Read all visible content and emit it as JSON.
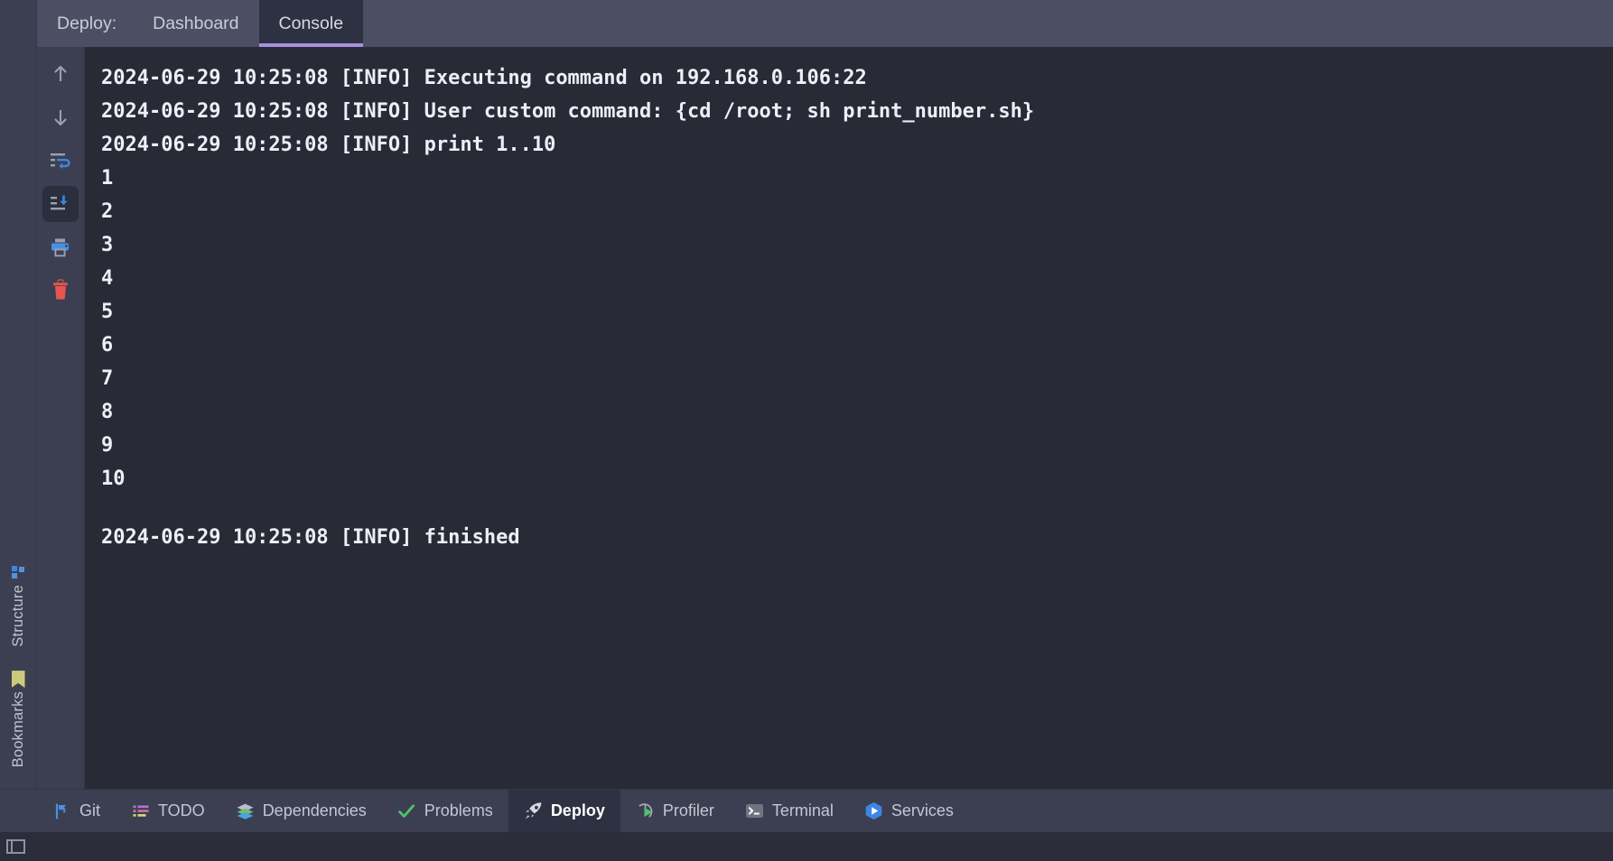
{
  "window": {
    "background_color": "#2b2d3a",
    "console_background": "#282b36",
    "panel_background": "#3c3f51",
    "accent_color": "#a98fe3"
  },
  "tabbar": {
    "title": "Deploy:",
    "tabs": [
      {
        "label": "Dashboard",
        "active": false
      },
      {
        "label": "Console",
        "active": true
      }
    ]
  },
  "action_toolbar": {
    "buttons": [
      {
        "name": "up-arrow-icon",
        "tooltip": "Up",
        "selected": false
      },
      {
        "name": "down-arrow-icon",
        "tooltip": "Down",
        "selected": false
      },
      {
        "name": "soft-wrap-icon",
        "tooltip": "Soft-Wrap",
        "selected": false
      },
      {
        "name": "scroll-to-end-icon",
        "tooltip": "Scroll to End",
        "selected": true
      },
      {
        "name": "print-icon",
        "tooltip": "Print",
        "selected": false
      },
      {
        "name": "trash-icon",
        "tooltip": "Clear All",
        "selected": false
      }
    ]
  },
  "console": {
    "lines": [
      {
        "text": "2024-06-29 10:25:08 [INFO] Executing command on 192.168.0.106:22",
        "kind": "log"
      },
      {
        "text": "2024-06-29 10:25:08 [INFO] User custom command: {cd /root; sh print_number.sh}",
        "kind": "log"
      },
      {
        "text": "2024-06-29 10:25:08 [INFO] print 1..10",
        "kind": "log"
      },
      {
        "text": "1",
        "kind": "out"
      },
      {
        "text": "2",
        "kind": "out"
      },
      {
        "text": "3",
        "kind": "out"
      },
      {
        "text": "4",
        "kind": "out"
      },
      {
        "text": "5",
        "kind": "out"
      },
      {
        "text": "6",
        "kind": "out"
      },
      {
        "text": "7",
        "kind": "out"
      },
      {
        "text": "8",
        "kind": "out"
      },
      {
        "text": "9",
        "kind": "out"
      },
      {
        "text": "10",
        "kind": "out"
      },
      {
        "text": "",
        "kind": "blank"
      },
      {
        "text": "2024-06-29 10:25:08 [INFO] finished",
        "kind": "log"
      }
    ]
  },
  "left_stripe": {
    "items": [
      {
        "label": "Structure",
        "icon": "structure-icon"
      },
      {
        "label": "Bookmarks",
        "icon": "bookmark-icon"
      }
    ]
  },
  "statusbar": {
    "buttons": [
      {
        "label": "Git",
        "icon": "git-branch-icon",
        "active": false
      },
      {
        "label": "TODO",
        "icon": "todo-list-icon",
        "active": false
      },
      {
        "label": "Dependencies",
        "icon": "layers-icon",
        "active": false
      },
      {
        "label": "Problems",
        "icon": "check-icon",
        "active": false
      },
      {
        "label": "Deploy",
        "icon": "rocket-icon",
        "active": true
      },
      {
        "label": "Profiler",
        "icon": "gauge-play-icon",
        "active": false
      },
      {
        "label": "Terminal",
        "icon": "terminal-icon",
        "active": false
      },
      {
        "label": "Services",
        "icon": "services-icon",
        "active": false
      }
    ]
  },
  "bottom_strip": {
    "layout_button": "layout-toggle-icon"
  }
}
